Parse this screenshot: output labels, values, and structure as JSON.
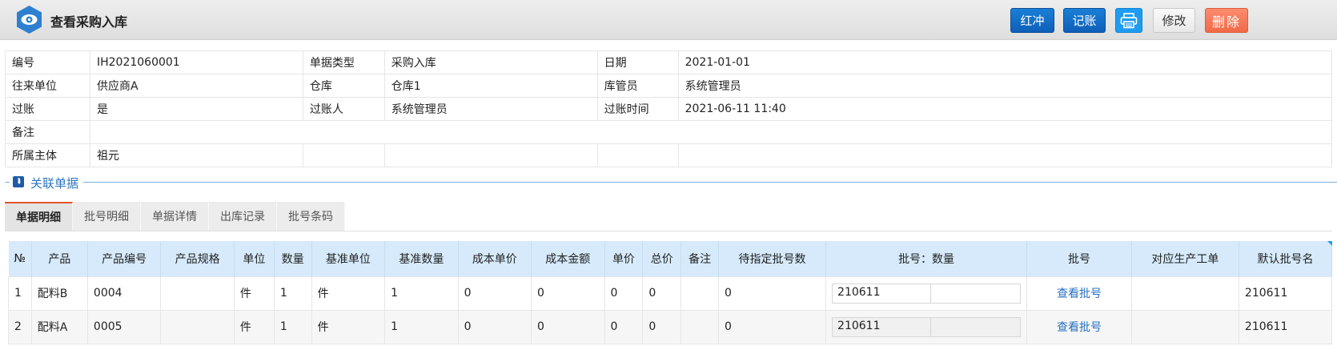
{
  "header": {
    "title": "查看采购入库",
    "buttons": {
      "hongchong": "红冲",
      "jizhang": "记账",
      "modify": "修改",
      "delete": "删除"
    }
  },
  "info": {
    "code_label": "编号",
    "code": "IH2021060001",
    "doctype_label": "单据类型",
    "doctype": "采购入库",
    "date_label": "日期",
    "date": "2021-01-01",
    "partner_label": "往来单位",
    "partner": "供应商A",
    "warehouse_label": "仓库",
    "warehouse": "仓库1",
    "keeper_label": "库管员",
    "keeper": "系统管理员",
    "posted_label": "过账",
    "posted": "是",
    "poster_label": "过账人",
    "poster": "系统管理员",
    "posttime_label": "过账时间",
    "posttime": "2021-06-11 11:40",
    "remark_label": "备注",
    "remark": "",
    "entity_label": "所属主体",
    "entity": "祖元"
  },
  "section": {
    "label": "关联单据"
  },
  "tabs": [
    "单据明细",
    "批号明细",
    "单据详情",
    "出库记录",
    "批号条码"
  ],
  "grid": {
    "columns": [
      "№",
      "产品",
      "产品编号",
      "产品规格",
      "单位",
      "数量",
      "基准单位",
      "基准数量",
      "成本单价",
      "成本金额",
      "单价",
      "总价",
      "备注",
      "待指定批号数",
      "批号：数量",
      "批号",
      "对应生产工单",
      "默认批号名"
    ],
    "rows": [
      {
        "no": "1",
        "product": "配料B",
        "code": "0004",
        "spec": "",
        "unit": "件",
        "qty": "1",
        "base_unit": "件",
        "base_qty": "1",
        "cost_price": "0",
        "cost_amount": "0",
        "price": "0",
        "total": "0",
        "remark": "",
        "pending": "0",
        "batch_qty": "210611",
        "batch_link": "查看批号",
        "work_order": "",
        "default_batch": "210611"
      },
      {
        "no": "2",
        "product": "配料A",
        "code": "0005",
        "spec": "",
        "unit": "件",
        "qty": "1",
        "base_unit": "件",
        "base_qty": "1",
        "cost_price": "0",
        "cost_amount": "0",
        "price": "0",
        "total": "0",
        "remark": "",
        "pending": "0",
        "batch_qty": "210611",
        "batch_link": "查看批号",
        "work_order": "",
        "default_batch": "210611"
      }
    ]
  },
  "colors": {
    "primary": "#0f5fb8",
    "print": "#1e9cf0",
    "delete": "#f06a48",
    "grid_header": "#d6eafb",
    "link": "#2670c2",
    "tab_active_accent": "#e0552f"
  },
  "icons": {
    "logo": "eye-icon",
    "print": "printer-icon",
    "expand": "double-chevron-down-icon"
  }
}
